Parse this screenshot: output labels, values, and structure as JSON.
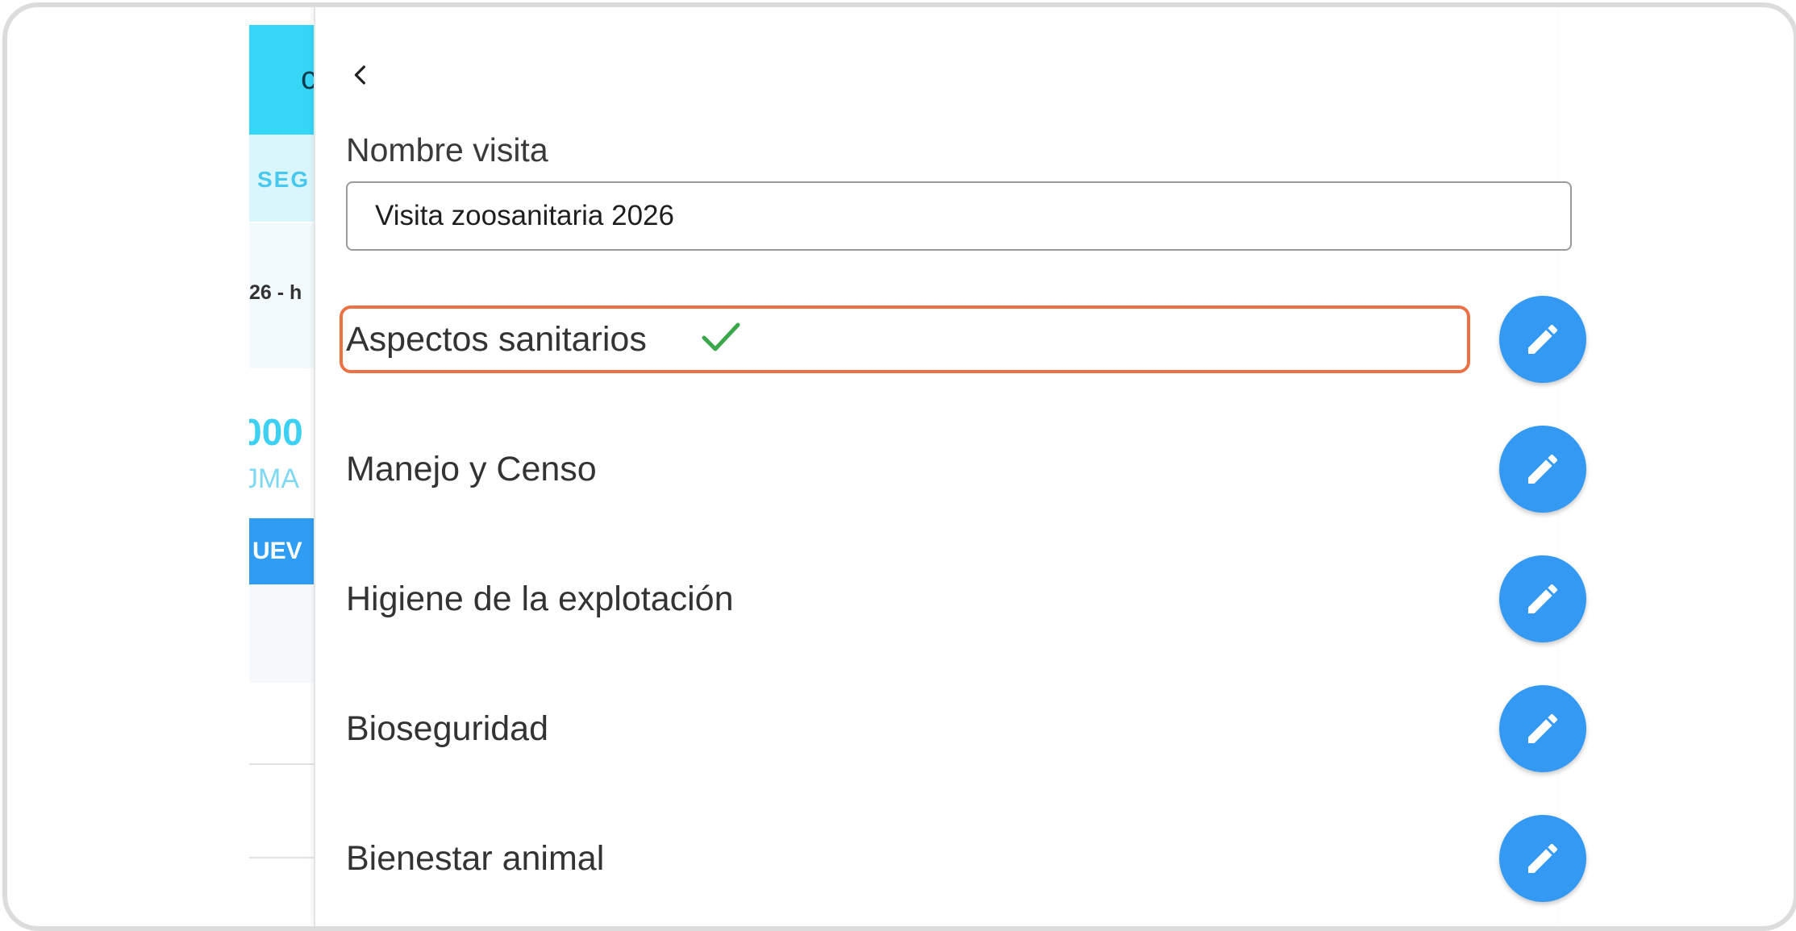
{
  "background": {
    "tab_label": "SEG",
    "date_text": "26 - h",
    "number_text": "000",
    "sub_text": "JMA",
    "new_button_label": "UEV"
  },
  "panel": {
    "back_icon": "chevron-left-icon",
    "name_field": {
      "label": "Nombre visita",
      "value": "Visita zoosanitaria 2026"
    },
    "sections": [
      {
        "label": "Aspectos sanitarios",
        "completed": true
      },
      {
        "label": "Manejo y Censo",
        "completed": false
      },
      {
        "label": "Higiene de la explotación",
        "completed": false
      },
      {
        "label": "Bioseguridad",
        "completed": false
      },
      {
        "label": "Bienestar animal",
        "completed": false
      }
    ]
  },
  "colors": {
    "accent_blue": "#3399f3",
    "header_cyan": "#36d6f7",
    "highlight_orange": "#ee7045",
    "check_green": "#3aa84a"
  }
}
